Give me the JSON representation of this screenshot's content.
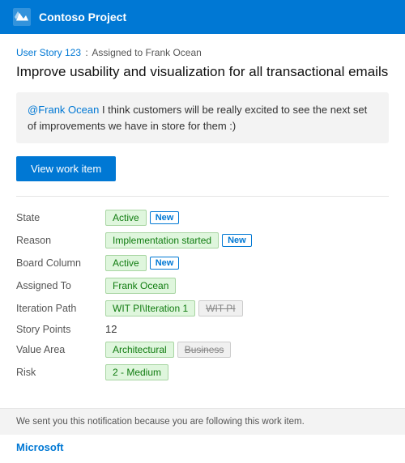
{
  "header": {
    "logo_alt": "Microsoft Azure DevOps Logo",
    "title": "Contoso Project"
  },
  "breadcrumb": {
    "link_text": "User Story 123",
    "separator": ":",
    "suffix": "Assigned to Frank Ocean"
  },
  "main_title": "Improve usability and visualization for all transactional emails",
  "comment": {
    "mention": "@Frank Ocean",
    "body": " I think customers will be really excited to see the next set of improvements we have in store for them :)"
  },
  "button": {
    "view_work_item": "View work item"
  },
  "fields": [
    {
      "label": "State",
      "values": [
        {
          "text": "Active",
          "style": "green"
        },
        {
          "text": "New",
          "style": "blue-outline"
        }
      ]
    },
    {
      "label": "Reason",
      "values": [
        {
          "text": "Implementation started",
          "style": "green"
        },
        {
          "text": "New",
          "style": "blue-outline"
        }
      ]
    },
    {
      "label": "Board Column",
      "values": [
        {
          "text": "Active",
          "style": "green"
        },
        {
          "text": "New",
          "style": "blue-outline"
        }
      ]
    },
    {
      "label": "Assigned To",
      "values": [
        {
          "text": "Frank Ocean",
          "style": "green"
        }
      ]
    },
    {
      "label": "Iteration Path",
      "values": [
        {
          "text": "WIT PI\\Iteration 1",
          "style": "green"
        },
        {
          "text": "WIT PI",
          "style": "strikethrough"
        }
      ]
    },
    {
      "label": "Story Points",
      "values": [
        {
          "text": "12",
          "style": "plain-text"
        }
      ]
    },
    {
      "label": "Value Area",
      "values": [
        {
          "text": "Architectural",
          "style": "green"
        },
        {
          "text": "Business",
          "style": "strikethrough"
        }
      ]
    },
    {
      "label": "Risk",
      "values": [
        {
          "text": "2 - Medium",
          "style": "green"
        }
      ]
    }
  ],
  "footer": {
    "note": "We sent you this notification because you are following this work item.",
    "brand": "Microsoft"
  }
}
